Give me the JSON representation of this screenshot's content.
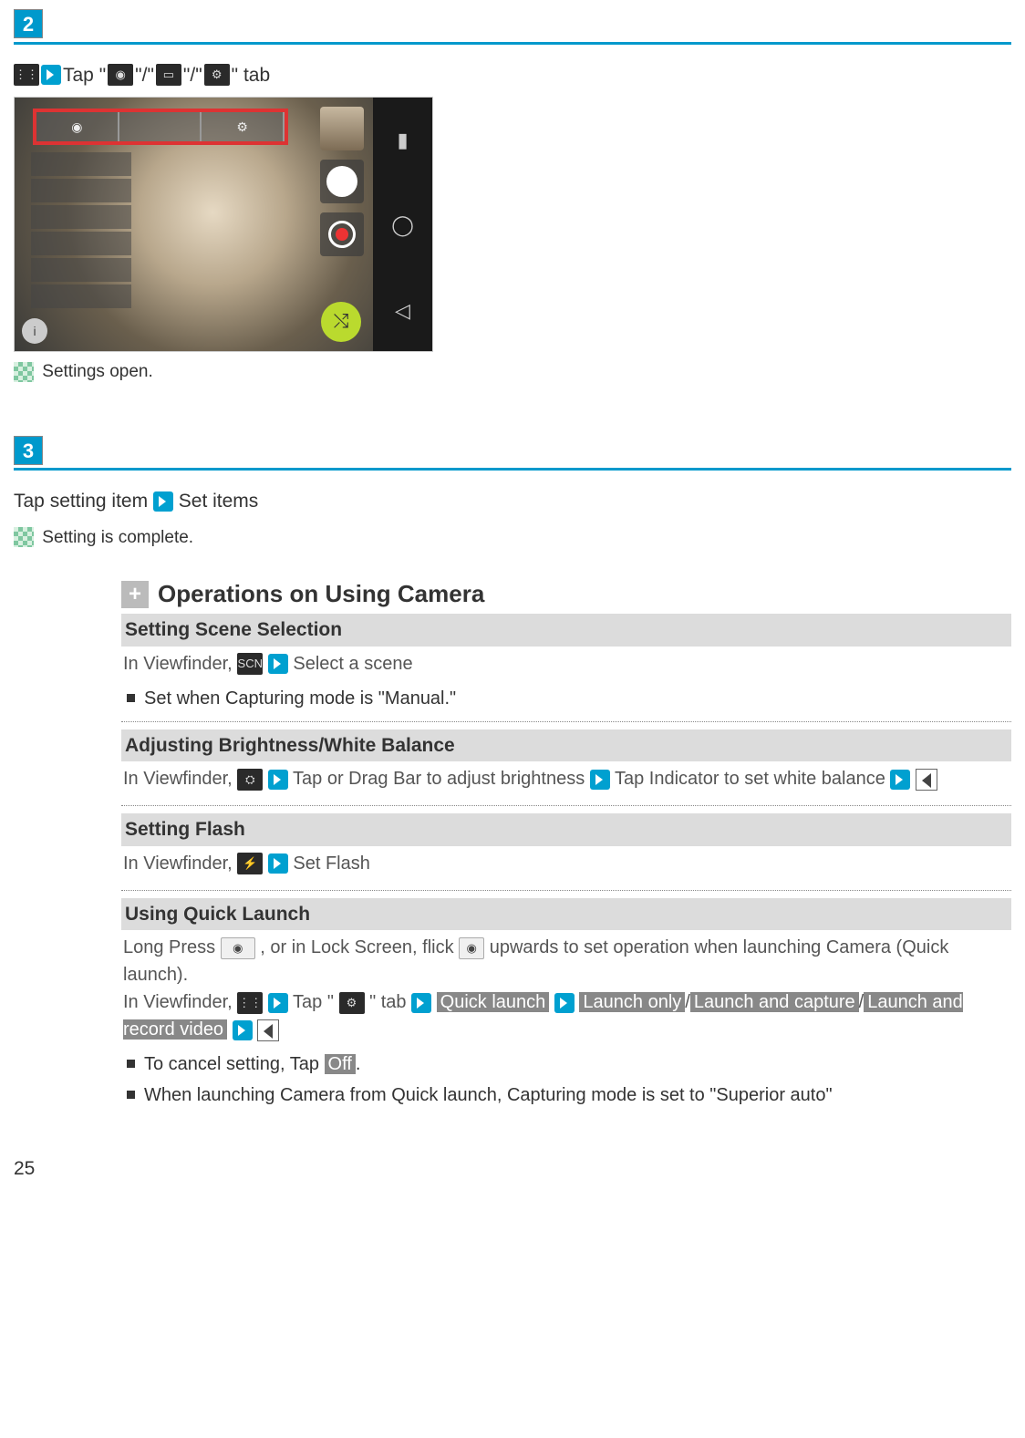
{
  "step2": {
    "tap_prefix": " Tap \"",
    "sep": "\"/\"",
    "tap_suffix": "\" tab",
    "result": "Settings open."
  },
  "step3": {
    "line_a": "Tap setting item",
    "line_b": " Set items",
    "result": "Setting is complete."
  },
  "ops_heading": "Operations on Using Camera",
  "ops": {
    "scene": {
      "title": "Setting Scene Selection",
      "body_a": "In Viewfinder, ",
      "body_b": " Select a scene",
      "bullet": "Set when Capturing mode is \"Manual.\""
    },
    "bw": {
      "title": "Adjusting Brightness/White Balance",
      "body_a": "In Viewfinder, ",
      "body_b": " Tap or Drag Bar to adjust brightness",
      "body_c": " Tap Indicator to set white balance"
    },
    "flash": {
      "title": "Setting Flash",
      "body_a": "In Viewfinder, ",
      "body_b": " Set Flash"
    },
    "quick": {
      "title": "Using Quick Launch",
      "body_a": "Long Press ",
      "body_b": " , or in Lock Screen, flick ",
      "body_c": " upwards to set operation when launching Camera (Quick launch).",
      "body_d": "In Viewfinder, ",
      "body_e": " Tap \"",
      "body_f": "\" tab",
      "btn_quick": "Quick launch",
      "btn_lo": "Launch only",
      "btn_lc": "Launch and capture",
      "btn_lr": "Launch and record video",
      "slash": "/",
      "bullet1_a": "To cancel setting, Tap ",
      "bullet1_off": "Off",
      "bullet1_b": ".",
      "bullet2": "When launching Camera from Quick launch, Capturing mode is set to \"Superior auto\""
    }
  },
  "page_number": "25"
}
